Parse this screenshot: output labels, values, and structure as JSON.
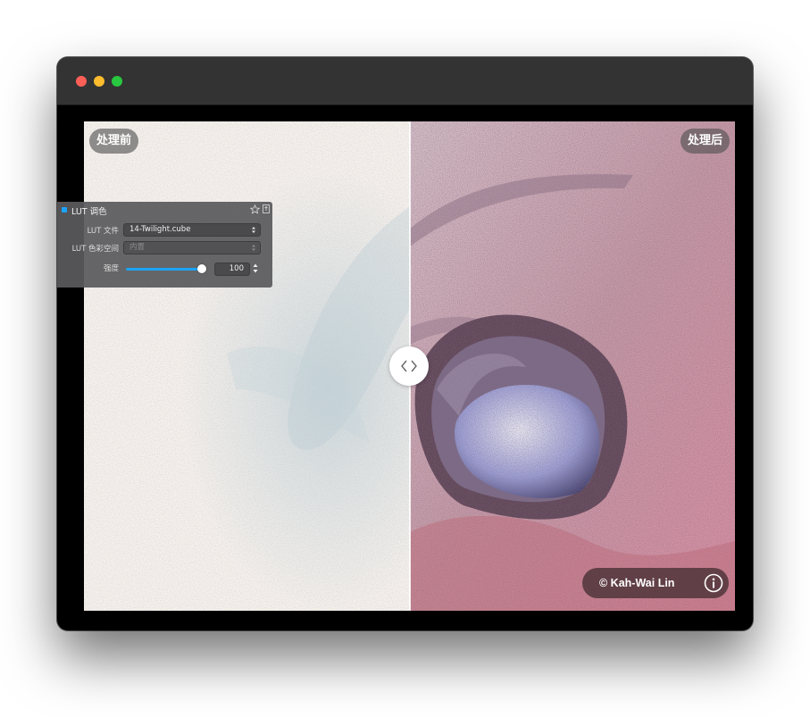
{
  "window": {
    "traffic_lights": {
      "close": "#fe5f57",
      "minimize": "#febc2e",
      "zoom": "#28c840"
    }
  },
  "compare": {
    "before_label": "处理前",
    "after_label": "处理后"
  },
  "credit": {
    "text": "© Kah-Wai Lin",
    "icon": "info-icon"
  },
  "panel": {
    "title": "LUT 调色",
    "enabled": true,
    "lut_file_label": "LUT 文件",
    "lut_file_value": "14-Twilight.cube",
    "colorspace_label": "LUT 色彩空间",
    "colorspace_value": "内置",
    "strength_label": "强度",
    "strength_value": "100",
    "strength_fraction": 1.0,
    "accent": "#19a4f5"
  }
}
